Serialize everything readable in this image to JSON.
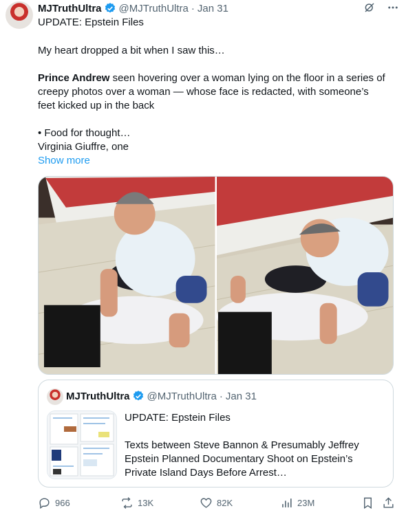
{
  "post": {
    "display_name": "MJTruthUltra",
    "handle": "@MJTruthUltra",
    "separator": "·",
    "date": "Jan 31",
    "lines": {
      "l1": "UPDATE: Epstein Files",
      "l2": "My heart dropped a bit when I saw this…",
      "l3_bold": "Prince Andrew",
      "l3_rest": " seen hovering over a woman lying on the floor in a series of",
      "l4": "creepy photos over a woman — whose face is redacted, with someone’s",
      "l5": "feet kicked up in the back",
      "l6": "• Food for thought…",
      "l7": "Virginia Giuffre, one"
    },
    "show_more": "Show more"
  },
  "quote": {
    "display_name": "MJTruthUltra",
    "handle": "@MJTruthUltra",
    "separator": "·",
    "date": "Jan 31",
    "title": "UPDATE: Epstein Files",
    "lines": [
      "Texts between Steve Bannon & Presumably Jeffrey",
      "Epstein Planned Documentary Shoot on Epstein’s",
      "Private Island Days Before Arrest…"
    ]
  },
  "actions": {
    "replies": "966",
    "reposts": "13K",
    "likes": "82K",
    "views": "23M"
  },
  "colors": {
    "accent": "#1d9bf0",
    "muted": "#536471",
    "text": "#0f1419",
    "border": "#cfd9de"
  },
  "icons": [
    "verified-badge-icon",
    "grok-icon",
    "more-icon",
    "reply-icon",
    "repost-icon",
    "like-icon",
    "views-icon",
    "bookmark-icon",
    "share-icon"
  ]
}
